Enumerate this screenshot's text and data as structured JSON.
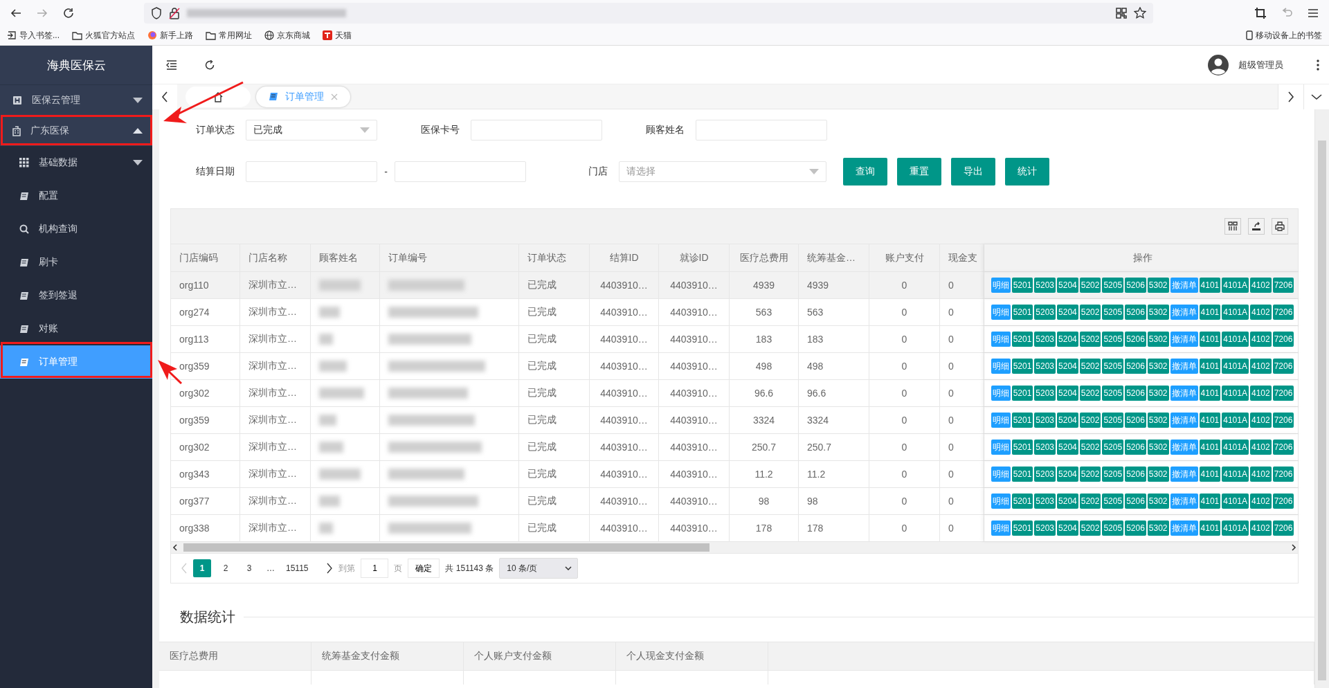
{
  "browser": {
    "bookmarks": [
      {
        "label": "导入书签..."
      },
      {
        "label": "火狐官方站点"
      },
      {
        "label": "新手上路"
      },
      {
        "label": "常用网址"
      },
      {
        "label": "京东商城"
      },
      {
        "label": "天猫"
      }
    ],
    "mobile_bookmarks": "移动设备上的书签"
  },
  "sidebar": {
    "title": "海典医保云",
    "items": [
      {
        "label": "医保云管理",
        "expanded": false,
        "selected": false
      },
      {
        "label": "广东医保",
        "expanded": true,
        "selected": false,
        "children": [
          {
            "label": "基础数据",
            "expanded": false,
            "selected": false
          },
          {
            "label": "配置",
            "selected": false
          },
          {
            "label": "机构查询",
            "selected": false
          },
          {
            "label": "刷卡",
            "selected": false
          },
          {
            "label": "签到签退",
            "selected": false
          },
          {
            "label": "对账",
            "selected": false
          },
          {
            "label": "订单管理",
            "selected": true
          }
        ]
      }
    ]
  },
  "header": {
    "user": "超级管理员"
  },
  "tabs": [
    {
      "kind": "home",
      "selected": false
    },
    {
      "kind": "page",
      "label": "订单管理",
      "selected": true
    }
  ],
  "filters": {
    "rows": [
      [
        {
          "kind": "select",
          "label": "订单状态",
          "value": "已完成"
        },
        {
          "kind": "input",
          "label": "医保卡号"
        },
        {
          "kind": "input",
          "label": "顾客姓名"
        }
      ],
      [
        {
          "kind": "range",
          "label": "结算日期",
          "separator": "-"
        },
        {
          "kind": "select",
          "label": "门店",
          "placeholder": "请选择"
        }
      ]
    ],
    "buttons": [
      "查询",
      "重置",
      "导出",
      "统计"
    ]
  },
  "table": {
    "columns": [
      {
        "label": "门店编码",
        "kind": "left"
      },
      {
        "label": "门店名称",
        "kind": "left"
      },
      {
        "label": "顾客姓名",
        "kind": "redacted"
      },
      {
        "label": "订单编号",
        "kind": "redacted"
      },
      {
        "label": "订单状态",
        "kind": "left"
      },
      {
        "label": "结算ID",
        "kind": "center"
      },
      {
        "label": "就诊ID",
        "kind": "center"
      },
      {
        "label": "医疗总费用",
        "kind": "center"
      },
      {
        "label": "统筹基金…",
        "kind": "left"
      },
      {
        "label": "账户支付",
        "kind": "center"
      },
      {
        "label": "现金支",
        "kind": "right"
      },
      {
        "label": "操作",
        "kind": "actions"
      }
    ],
    "rows": [
      {
        "selected": true,
        "cells": [
          "org110",
          "深圳市立…",
          "",
          "",
          "已完成",
          "4403910…",
          "4403910…",
          "4939",
          "4939",
          "0",
          "0"
        ],
        "actions": [
          {
            "label": "明细",
            "kind": "info"
          },
          {
            "label": "5201",
            "kind": "primary"
          },
          {
            "label": "5203",
            "kind": "primary"
          },
          {
            "label": "5204",
            "kind": "primary"
          },
          {
            "label": "5202",
            "kind": "primary"
          },
          {
            "label": "5205",
            "kind": "primary"
          },
          {
            "label": "5206",
            "kind": "primary"
          },
          {
            "label": "5302",
            "kind": "primary"
          },
          {
            "label": "撤清单",
            "kind": "info"
          },
          {
            "label": "4101",
            "kind": "primary"
          },
          {
            "label": "4101A",
            "kind": "primary"
          },
          {
            "label": "4102",
            "kind": "primary"
          },
          {
            "label": "7206",
            "kind": "primary"
          }
        ]
      },
      {
        "selected": false,
        "cells": [
          "org274",
          "深圳市立…",
          "",
          "",
          "已完成",
          "4403910…",
          "4403910…",
          "563",
          "563",
          "0",
          "0"
        ],
        "actions": [
          {
            "label": "明细",
            "kind": "info"
          },
          {
            "label": "5201",
            "kind": "primary"
          },
          {
            "label": "5203",
            "kind": "primary"
          },
          {
            "label": "5204",
            "kind": "primary"
          },
          {
            "label": "5202",
            "kind": "primary"
          },
          {
            "label": "5205",
            "kind": "primary"
          },
          {
            "label": "5206",
            "kind": "primary"
          },
          {
            "label": "5302",
            "kind": "primary"
          },
          {
            "label": "撤清单",
            "kind": "info"
          },
          {
            "label": "4101",
            "kind": "primary"
          },
          {
            "label": "4101A",
            "kind": "primary"
          },
          {
            "label": "4102",
            "kind": "primary"
          },
          {
            "label": "7206",
            "kind": "primary"
          }
        ]
      },
      {
        "selected": false,
        "cells": [
          "org113",
          "深圳市立…",
          "",
          "",
          "已完成",
          "4403910…",
          "4403910…",
          "183",
          "183",
          "0",
          "0"
        ],
        "actions": [
          {
            "label": "明细",
            "kind": "info"
          },
          {
            "label": "5201",
            "kind": "primary"
          },
          {
            "label": "5203",
            "kind": "primary"
          },
          {
            "label": "5204",
            "kind": "primary"
          },
          {
            "label": "5202",
            "kind": "primary"
          },
          {
            "label": "5205",
            "kind": "primary"
          },
          {
            "label": "5206",
            "kind": "primary"
          },
          {
            "label": "5302",
            "kind": "primary"
          },
          {
            "label": "撤清单",
            "kind": "info"
          },
          {
            "label": "4101",
            "kind": "primary"
          },
          {
            "label": "4101A",
            "kind": "primary"
          },
          {
            "label": "4102",
            "kind": "primary"
          },
          {
            "label": "7206",
            "kind": "primary"
          }
        ]
      },
      {
        "selected": false,
        "cells": [
          "org359",
          "深圳市立…",
          "",
          "",
          "已完成",
          "4403910…",
          "4403910…",
          "498",
          "498",
          "0",
          "0"
        ],
        "actions": [
          {
            "label": "明细",
            "kind": "info"
          },
          {
            "label": "5201",
            "kind": "primary"
          },
          {
            "label": "5203",
            "kind": "primary"
          },
          {
            "label": "5204",
            "kind": "primary"
          },
          {
            "label": "5202",
            "kind": "primary"
          },
          {
            "label": "5205",
            "kind": "primary"
          },
          {
            "label": "5206",
            "kind": "primary"
          },
          {
            "label": "5302",
            "kind": "primary"
          },
          {
            "label": "撤清单",
            "kind": "info"
          },
          {
            "label": "4101",
            "kind": "primary"
          },
          {
            "label": "4101A",
            "kind": "primary"
          },
          {
            "label": "4102",
            "kind": "primary"
          },
          {
            "label": "7206",
            "kind": "primary"
          }
        ]
      },
      {
        "selected": false,
        "cells": [
          "org302",
          "深圳市立…",
          "",
          "",
          "已完成",
          "4403910…",
          "4403910…",
          "96.6",
          "96.6",
          "0",
          "0"
        ],
        "actions": [
          {
            "label": "明细",
            "kind": "info"
          },
          {
            "label": "5201",
            "kind": "primary"
          },
          {
            "label": "5203",
            "kind": "primary"
          },
          {
            "label": "5204",
            "kind": "primary"
          },
          {
            "label": "5202",
            "kind": "primary"
          },
          {
            "label": "5205",
            "kind": "primary"
          },
          {
            "label": "5206",
            "kind": "primary"
          },
          {
            "label": "5302",
            "kind": "primary"
          },
          {
            "label": "撤清单",
            "kind": "info"
          },
          {
            "label": "4101",
            "kind": "primary"
          },
          {
            "label": "4101A",
            "kind": "primary"
          },
          {
            "label": "4102",
            "kind": "primary"
          },
          {
            "label": "7206",
            "kind": "primary"
          }
        ]
      },
      {
        "selected": false,
        "cells": [
          "org359",
          "深圳市立…",
          "",
          "",
          "已完成",
          "4403910…",
          "4403910…",
          "3324",
          "3324",
          "0",
          "0"
        ],
        "actions": [
          {
            "label": "明细",
            "kind": "info"
          },
          {
            "label": "5201",
            "kind": "primary"
          },
          {
            "label": "5203",
            "kind": "primary"
          },
          {
            "label": "5204",
            "kind": "primary"
          },
          {
            "label": "5202",
            "kind": "primary"
          },
          {
            "label": "5205",
            "kind": "primary"
          },
          {
            "label": "5206",
            "kind": "primary"
          },
          {
            "label": "5302",
            "kind": "primary"
          },
          {
            "label": "撤清单",
            "kind": "info"
          },
          {
            "label": "4101",
            "kind": "primary"
          },
          {
            "label": "4101A",
            "kind": "primary"
          },
          {
            "label": "4102",
            "kind": "primary"
          },
          {
            "label": "7206",
            "kind": "primary"
          }
        ]
      },
      {
        "selected": false,
        "cells": [
          "org302",
          "深圳市立…",
          "",
          "",
          "已完成",
          "4403910…",
          "4403910…",
          "250.7",
          "250.7",
          "0",
          "0"
        ],
        "actions": [
          {
            "label": "明细",
            "kind": "info"
          },
          {
            "label": "5201",
            "kind": "primary"
          },
          {
            "label": "5203",
            "kind": "primary"
          },
          {
            "label": "5204",
            "kind": "primary"
          },
          {
            "label": "5202",
            "kind": "primary"
          },
          {
            "label": "5205",
            "kind": "primary"
          },
          {
            "label": "5206",
            "kind": "primary"
          },
          {
            "label": "5302",
            "kind": "primary"
          },
          {
            "label": "撤清单",
            "kind": "info"
          },
          {
            "label": "4101",
            "kind": "primary"
          },
          {
            "label": "4101A",
            "kind": "primary"
          },
          {
            "label": "4102",
            "kind": "primary"
          },
          {
            "label": "7206",
            "kind": "primary"
          }
        ]
      },
      {
        "selected": false,
        "cells": [
          "org343",
          "深圳市立…",
          "",
          "",
          "已完成",
          "4403910…",
          "4403910…",
          "11.2",
          "11.2",
          "0",
          "0"
        ],
        "actions": [
          {
            "label": "明细",
            "kind": "info"
          },
          {
            "label": "5201",
            "kind": "primary"
          },
          {
            "label": "5203",
            "kind": "primary"
          },
          {
            "label": "5204",
            "kind": "primary"
          },
          {
            "label": "5202",
            "kind": "primary"
          },
          {
            "label": "5205",
            "kind": "primary"
          },
          {
            "label": "5206",
            "kind": "primary"
          },
          {
            "label": "5302",
            "kind": "primary"
          },
          {
            "label": "撤清单",
            "kind": "info"
          },
          {
            "label": "4101",
            "kind": "primary"
          },
          {
            "label": "4101A",
            "kind": "primary"
          },
          {
            "label": "4102",
            "kind": "primary"
          },
          {
            "label": "7206",
            "kind": "primary"
          }
        ]
      },
      {
        "selected": false,
        "cells": [
          "org377",
          "深圳市立…",
          "",
          "",
          "已完成",
          "4403910…",
          "4403910…",
          "98",
          "98",
          "0",
          "0"
        ],
        "actions": [
          {
            "label": "明细",
            "kind": "info"
          },
          {
            "label": "5201",
            "kind": "primary"
          },
          {
            "label": "5203",
            "kind": "primary"
          },
          {
            "label": "5204",
            "kind": "primary"
          },
          {
            "label": "5202",
            "kind": "primary"
          },
          {
            "label": "5205",
            "kind": "primary"
          },
          {
            "label": "5206",
            "kind": "primary"
          },
          {
            "label": "5302",
            "kind": "primary"
          },
          {
            "label": "撤清单",
            "kind": "info"
          },
          {
            "label": "4101",
            "kind": "primary"
          },
          {
            "label": "4101A",
            "kind": "primary"
          },
          {
            "label": "4102",
            "kind": "primary"
          },
          {
            "label": "7206",
            "kind": "primary"
          }
        ]
      },
      {
        "selected": false,
        "cells": [
          "org338",
          "深圳市立…",
          "",
          "",
          "已完成",
          "4403910…",
          "4403910…",
          "178",
          "178",
          "0",
          "0"
        ],
        "actions": [
          {
            "label": "明细",
            "kind": "info"
          },
          {
            "label": "5201",
            "kind": "primary"
          },
          {
            "label": "5203",
            "kind": "primary"
          },
          {
            "label": "5204",
            "kind": "primary"
          },
          {
            "label": "5202",
            "kind": "primary"
          },
          {
            "label": "5205",
            "kind": "primary"
          },
          {
            "label": "5206",
            "kind": "primary"
          },
          {
            "label": "5302",
            "kind": "primary"
          },
          {
            "label": "撤清单",
            "kind": "info"
          },
          {
            "label": "4101",
            "kind": "primary"
          },
          {
            "label": "4101A",
            "kind": "primary"
          },
          {
            "label": "4102",
            "kind": "primary"
          },
          {
            "label": "7206",
            "kind": "primary"
          }
        ]
      }
    ]
  },
  "pagination": {
    "pages": [
      {
        "label": "1",
        "kind": "page",
        "selected": true
      },
      {
        "label": "2",
        "kind": "page",
        "selected": false
      },
      {
        "label": "3",
        "kind": "page",
        "selected": false
      },
      {
        "label": "…",
        "kind": "ellipsis"
      },
      {
        "label": "15115",
        "kind": "page",
        "selected": false
      }
    ],
    "goto": "到第",
    "page_input": "1",
    "page_unit": "页",
    "confirm": "确定",
    "total": "共 151143 条",
    "page_size": "10 条/页"
  },
  "stats": {
    "title": "数据统计",
    "columns": [
      "医疗总费用",
      "统筹基金支付金额",
      "个人账户支付金额",
      "个人现金支付金额"
    ]
  }
}
